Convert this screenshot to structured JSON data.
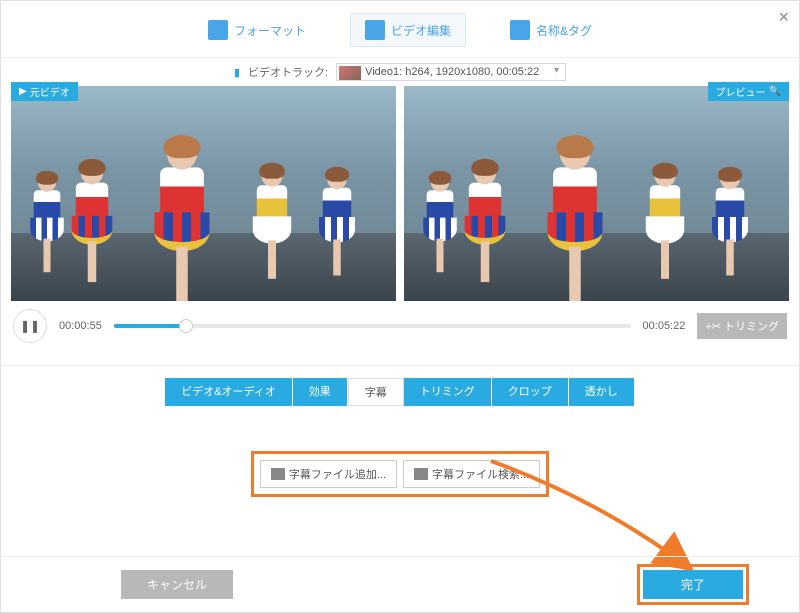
{
  "top_tabs": {
    "format": "フォーマット",
    "video_edit": "ビデオ編集",
    "name_tag": "名称&タグ"
  },
  "track": {
    "label": "ビデオトラック:",
    "selected": "Video1: h264, 1920x1080, 00:05:22"
  },
  "badges": {
    "left": "元ビデオ",
    "right": "プレビュー"
  },
  "time": {
    "current": "00:00:55",
    "total": "00:05:22"
  },
  "trim_label": "トリミング",
  "edit_tabs": [
    "ビデオ&オーディオ",
    "効果",
    "字幕",
    "トリミング",
    "クロップ",
    "透かし"
  ],
  "active_edit_tab": 2,
  "sub_buttons": {
    "add": "字幕ファイル追加...",
    "search": "字幕ファイル検索..."
  },
  "footer": {
    "cancel": "キャンセル",
    "done": "完了"
  }
}
